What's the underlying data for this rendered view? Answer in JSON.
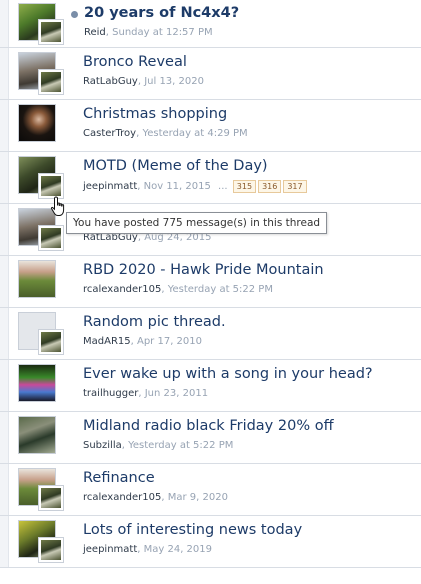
{
  "threads": [
    {
      "title": "20 years of Nc4x4?",
      "author": "Reid",
      "time": "Sunday at 12:57 PM",
      "unread": true
    },
    {
      "title": "Bronco Reveal",
      "author": "RatLabGuy",
      "time": "Jul 13, 2020"
    },
    {
      "title": "Christmas shopping",
      "author": "CasterTroy",
      "time": "Yesterday at 4:29 PM"
    },
    {
      "title": "MOTD (Meme of the Day)",
      "author": "jeepinmatt",
      "time": "Nov 11, 2015",
      "pages": [
        "315",
        "316",
        "317"
      ]
    },
    {
      "title": "",
      "author": "RatLabGuy",
      "time": "Aug 24, 2015"
    },
    {
      "title": "RBD 2020 - Hawk Pride Mountain",
      "author": "rcalexander105",
      "time": "Yesterday at 5:22 PM"
    },
    {
      "title": "Random pic thread.",
      "author": "MadAR15",
      "time": "Apr 17, 2010"
    },
    {
      "title": "Ever wake up with a song in your head?",
      "author": "trailhugger",
      "time": "Jun 23, 2011"
    },
    {
      "title": "Midland radio black Friday 20% off",
      "author": "Subzilla",
      "time": "Yesterday at 5:22 PM"
    },
    {
      "title": "Refinance",
      "author": "rcalexander105",
      "time": "Mar 9, 2020"
    },
    {
      "title": "Lots of interesting news today",
      "author": "jeepinmatt",
      "time": "May 24, 2019"
    }
  ],
  "tooltip": "You have posted 775 message(s) in this thread",
  "pagination_ellipsis": "...",
  "separator": ", ",
  "colors": {
    "title": "#1d3b68",
    "meta": "#97a3b3",
    "author": "#2f3b4a",
    "page_badge_border": "#e7c99b"
  }
}
